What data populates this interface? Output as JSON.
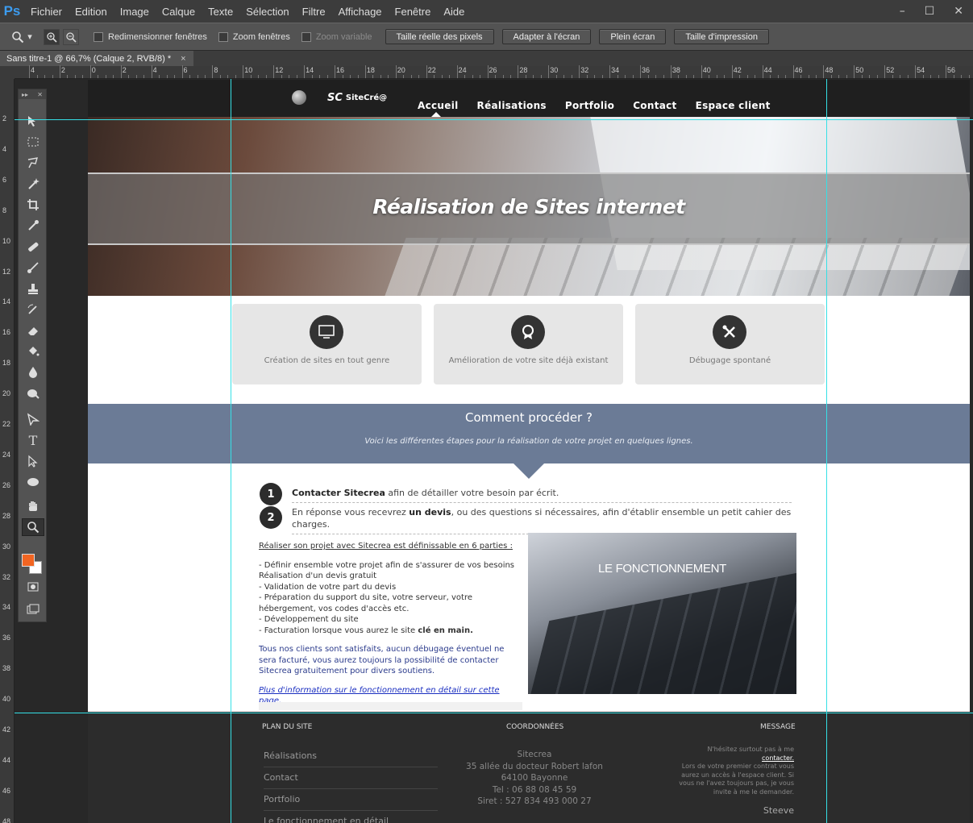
{
  "menu": {
    "logo": "Ps",
    "items": [
      "Fichier",
      "Edition",
      "Image",
      "Calque",
      "Texte",
      "Sélection",
      "Filtre",
      "Affichage",
      "Fenêtre",
      "Aide"
    ],
    "window_controls": [
      "–",
      "☐",
      "✕"
    ]
  },
  "options": {
    "chk_redim": "Redimensionner fenêtres",
    "chk_zoomwin": "Zoom fenêtres",
    "chk_zoomvar": "Zoom variable",
    "btn_actual": "Taille réelle des pixels",
    "btn_fit": "Adapter à l'écran",
    "btn_full": "Plein écran",
    "btn_print": "Taille d'impression"
  },
  "doc_tab": {
    "title": "Sans titre-1 @ 66,7% (Calque 2, RVB/8) *",
    "close": "×"
  },
  "ruler_h_labels": [
    "4",
    "2",
    "0",
    "2",
    "4",
    "6",
    "8",
    "10",
    "12",
    "14",
    "16",
    "18",
    "20",
    "22",
    "24",
    "26",
    "28",
    "30",
    "32",
    "34",
    "36",
    "38",
    "40",
    "42",
    "44",
    "46",
    "48",
    "50",
    "52",
    "54",
    "56"
  ],
  "ruler_v_labels": [
    "2",
    "4",
    "6",
    "8",
    "10",
    "12",
    "14",
    "16",
    "18",
    "20",
    "22",
    "24",
    "26",
    "28",
    "30",
    "32",
    "34",
    "36",
    "38",
    "40",
    "42",
    "44",
    "46",
    "48"
  ],
  "colors": {
    "foreground": "#f26522",
    "background": "#ffffff",
    "guides": "#35e0e6"
  },
  "site": {
    "logo_mark": "SC",
    "logo_name": "SiteCré@",
    "nav": [
      "Accueil",
      "Réalisations",
      "Portfolio",
      "Contact",
      "Espace client"
    ],
    "hero_title": "Réalisation de Sites internet",
    "cards": [
      {
        "label": "Création de sites en tout genre",
        "icon": "website-icon"
      },
      {
        "label": "Amélioration de votre site déjà existant",
        "icon": "badge-icon"
      },
      {
        "label": "Débugage spontané",
        "icon": "tools-icon"
      }
    ],
    "process_title": "Comment procéder ?",
    "process_sub": "Voici les différentes étapes pour la réalisation de votre projet en quelques lignes.",
    "steps": [
      {
        "num": "1",
        "bold": "Contacter Sitecrea",
        "text": " afin de détailler votre besoin par écrit."
      },
      {
        "num": "2",
        "pre": "En réponse vous recevrez ",
        "bold": "un devis",
        "text": ", ou des questions si nécessaires, afin d'établir ensemble un petit cahier des charges."
      }
    ],
    "parts_intro": "Réaliser son projet avec Sitecrea est définissable en 6 parties :",
    "parts": [
      "- Définir ensemble votre projet afin de s'assurer de vos besoins",
      "  Réalisation d'un devis gratuit",
      "- Validation de votre part du devis",
      "- Préparation du support du site, votre serveur, votre hébergement, vos codes d'accès etc.",
      "- Développement du site",
      "- Facturation lorsque vous aurez le site "
    ],
    "parts_last_bold": "clé en main.",
    "satisfied": "Tous nos clients sont satisfaits, aucun débugage éventuel ne sera facturé, vous aurez toujours la possibilité de contacter Sitecrea gratuitement pour divers soutiens.",
    "more_link": "Plus d'information sur le fonctionnement en détail sur cette page.",
    "image_title": "LE FONCTIONNEMENT",
    "footer": {
      "h_plan": "PLAN DU SITE",
      "h_coord": "COORDONNÉES",
      "h_msg": "MESSAGE",
      "links": [
        "Réalisations",
        "Contact",
        "Portfolio",
        "Le fonctionnement en détail"
      ],
      "coord": [
        "Sitecrea",
        "35 allée du docteur Robert lafon",
        "64100 Bayonne",
        "Tel : 06 88 08 45 59",
        "Siret : 527 834 493 000 27"
      ],
      "msg1": "N'hésitez surtout pas à me",
      "msg_link": "contacter.",
      "msg2": "Lors de votre premier contrat vous aurez un accès à l'espace client. Si vous ne l'avez toujours pas, je vous invite à me le demander.",
      "sign": "Steeve"
    }
  }
}
